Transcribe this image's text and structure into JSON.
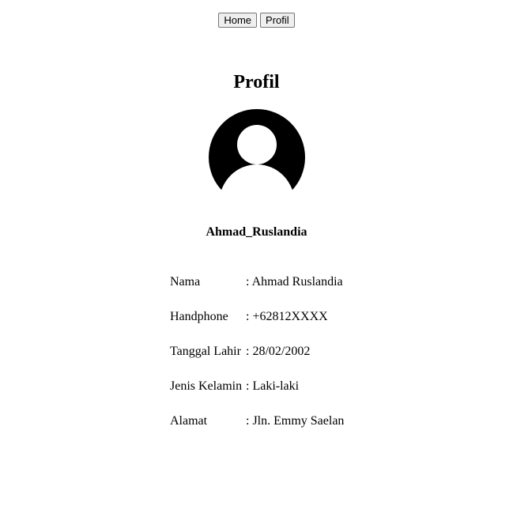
{
  "nav": {
    "home_label": "Home",
    "profil_label": "Profil"
  },
  "page": {
    "title": "Profil"
  },
  "profile": {
    "avatar_icon": "user-avatar-icon",
    "username": "Ahmad_Ruslandia",
    "fields": [
      {
        "label": "Nama",
        "value": ": Ahmad Ruslandia"
      },
      {
        "label": "Handphone",
        "value": ": +62812XXXX"
      },
      {
        "label": "Tanggal Lahir",
        "value": ": 28/02/2002"
      },
      {
        "label": "Jenis Kelamin",
        "value": ": Laki-laki"
      },
      {
        "label": "Alamat",
        "value": ": Jln. Emmy Saelan"
      }
    ]
  }
}
